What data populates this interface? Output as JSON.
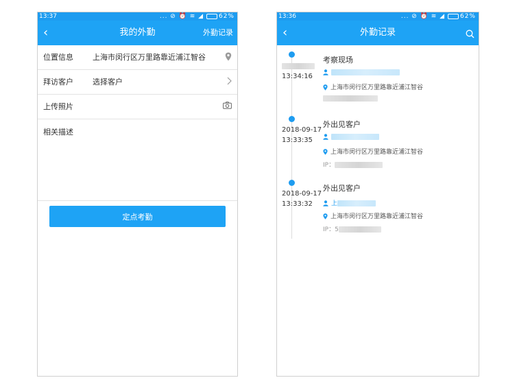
{
  "left": {
    "status": {
      "time": "13:37",
      "icons": "... ⊘ ⏰ ≋ ◢",
      "battery": "62%"
    },
    "nav": {
      "back": "‹",
      "title": "我的外勤",
      "action": "外勤记录"
    },
    "rows": [
      {
        "label": "位置信息",
        "value": "上海市闵行区万里路靠近浦江智谷",
        "icon": "location-pin-icon"
      },
      {
        "label": "拜访客户",
        "value": "选择客户",
        "icon": "chevron-right-icon"
      },
      {
        "label": "上传照片",
        "value": "",
        "icon": "camera-icon"
      }
    ],
    "description_label": "相关描述",
    "submit_label": "定点考勤"
  },
  "right": {
    "status": {
      "time": "13:36",
      "icons": "... ⊘ ⏰ ≋ ◢",
      "battery": "62%"
    },
    "nav": {
      "back": "‹",
      "title": "外勤记录",
      "icon": "search-icon"
    },
    "records": [
      {
        "date": "",
        "time": "13:34:16",
        "title": "考察现场",
        "user": "",
        "address": "上海市闵行区万里路靠近浦江智谷",
        "ip": ""
      },
      {
        "date": "2018-09-17",
        "time": "13:33:35",
        "title": "外出见客户",
        "user": "",
        "address": "上海市闵行区万里路靠近浦江智谷",
        "ip": "IP："
      },
      {
        "date": "2018-09-17",
        "time": "13:33:32",
        "title": "外出见客户",
        "user": "上",
        "address": "上海市闵行区万里路靠近浦江智谷",
        "ip": "IP：5"
      }
    ]
  },
  "colors": {
    "primary": "#1ea3f5",
    "status_bar": "#1e9cf0",
    "divider": "#e3e3e3"
  }
}
